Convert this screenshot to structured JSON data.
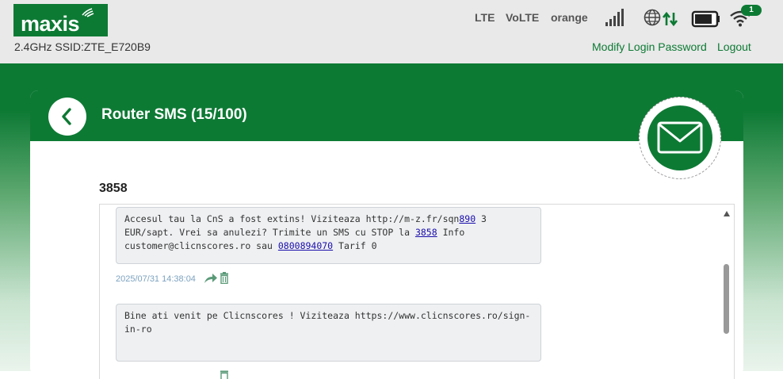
{
  "brand": {
    "name": "maxis"
  },
  "header": {
    "ssid": "2.4GHz SSID:ZTE_E720B9",
    "network_type": "LTE",
    "volte": "VoLTE",
    "carrier": "orange",
    "wifi_badge": "1",
    "modify_password": "Modify Login Password",
    "logout": "Logout",
    "icons": [
      "signal-bars-icon",
      "globe-icon",
      "data-transfer-arrows-icon",
      "battery-icon",
      "wifi-icon"
    ]
  },
  "page": {
    "title": "Router SMS (15/100)",
    "sender": "3858"
  },
  "messages": [
    {
      "text_parts": [
        "Accesul tau la CnS a fost extins! Viziteaza http://m-z.fr/sqn",
        "890",
        " 3",
        "EUR/sapt. Vrei sa anulezi? Trimite un SMS cu STOP la ",
        "3858",
        " Info",
        "customer@clicnscores.ro sau ",
        "0800894070",
        " Tarif 0"
      ],
      "timestamp": "2025/07/31 14:38:04"
    },
    {
      "text_lines": [
        "Bine ati venit pe Clicnscores ! Viziteaza https://www.clicnscores.ro/sign-",
        "in-ro"
      ]
    }
  ],
  "colors": {
    "brand_green": "#0d7a34",
    "link": "#1a0dab",
    "timestamp": "#7da3c0"
  }
}
